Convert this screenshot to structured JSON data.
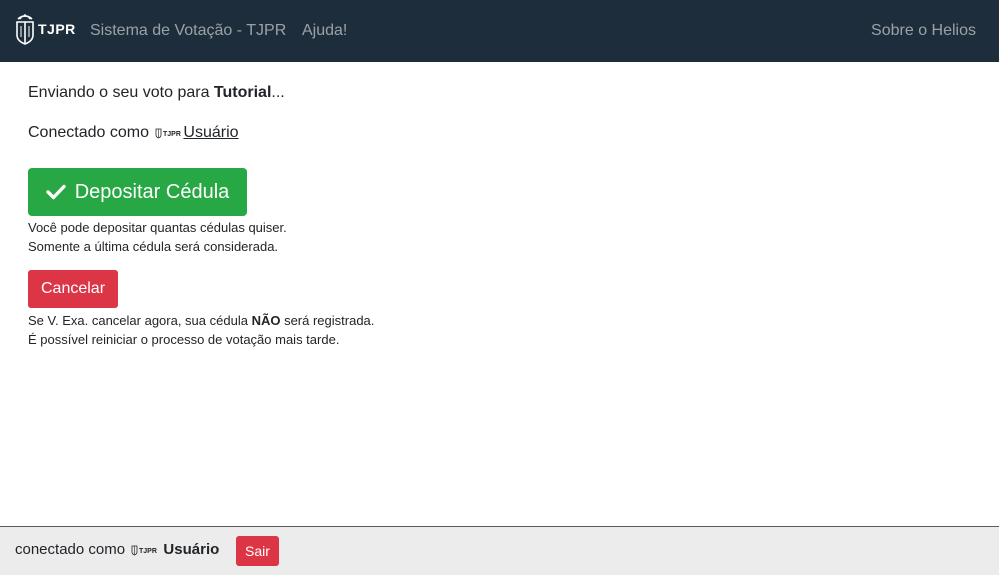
{
  "colors": {
    "navbar": "#1e2d3b",
    "deposit_button": "#28a745",
    "cancel_button": "#dc3545",
    "footer": "#ececec"
  },
  "navbar": {
    "brand_text": "TJPR",
    "brand_icon": "tjpr-logo-icon",
    "links": [
      {
        "label": "Sistema de Votação - TJPR"
      },
      {
        "label": "Ajuda!"
      }
    ],
    "right_link": "Sobre o Helios"
  },
  "main": {
    "sending_prefix": "Enviando o seu voto para ",
    "election_name": "Tutorial",
    "sending_suffix": "...",
    "connected_prefix": "Conectado como",
    "user_name": "Usuário",
    "deposit_button": {
      "label": "Depositar Cédula",
      "icon": "check-icon"
    },
    "deposit_note_1": "Você pode depositar quantas cédulas quiser.",
    "deposit_note_2": "Somente a última cédula será considerada.",
    "cancel_button": "Cancelar",
    "cancel_note_prefix": "Se V. Exa. cancelar agora, sua cédula ",
    "cancel_note_bold": "NÃO",
    "cancel_note_suffix": " será registrada.",
    "cancel_note_2": "É possível reiniciar o processo de votação mais tarde."
  },
  "footer": {
    "connected_prefix": "conectado como",
    "user_name": "Usuário",
    "logout_button": "Sair"
  }
}
